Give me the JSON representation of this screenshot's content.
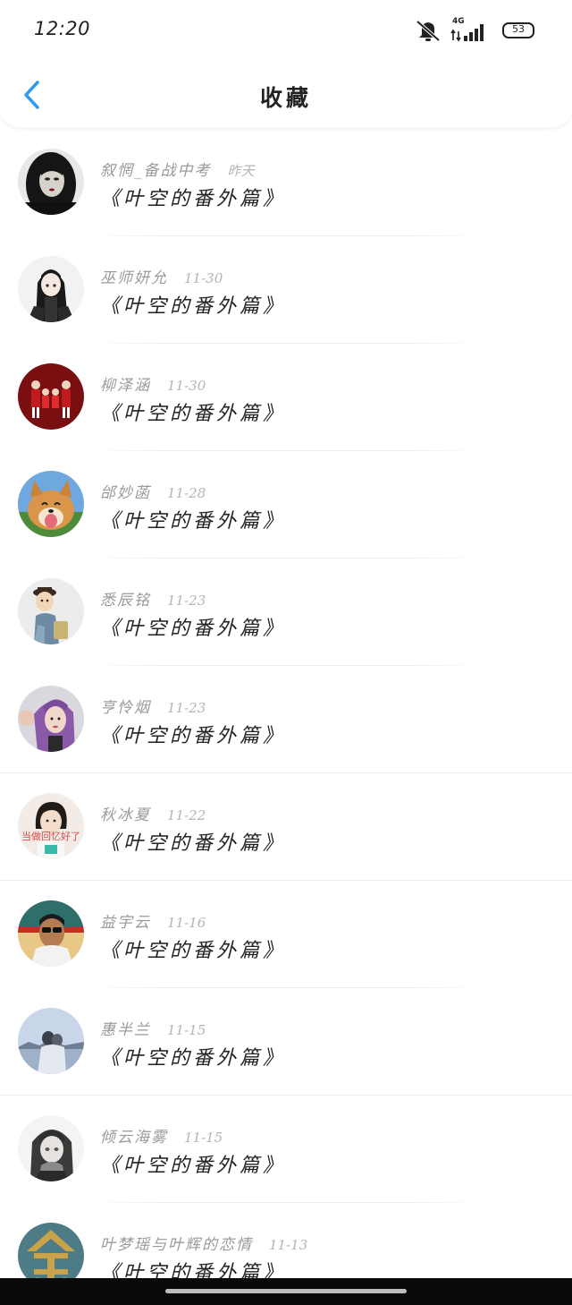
{
  "status_bar": {
    "time": "12:20",
    "network": "4G",
    "battery": "53"
  },
  "nav": {
    "title": "收藏"
  },
  "items": [
    {
      "author": "叙惘_备战中考",
      "date": "昨天",
      "title": "《叶空的番外篇》",
      "avatar": "dark-haired-girl-avatar"
    },
    {
      "author": "巫师妍允",
      "date": "11-30",
      "title": "《叶空的番外篇》",
      "avatar": "anime-girl-avatar"
    },
    {
      "author": "柳泽涵",
      "date": "11-30",
      "title": "《叶空的番外篇》",
      "avatar": "family-red-avatar"
    },
    {
      "author": "邰妙菡",
      "date": "11-28",
      "title": "《叶空的番外篇》",
      "avatar": "shiba-dog-avatar"
    },
    {
      "author": "悉辰铭",
      "date": "11-23",
      "title": "《叶空的番外篇》",
      "avatar": "cartoon-boy-avatar"
    },
    {
      "author": "亨怜烟",
      "date": "11-23",
      "title": "《叶空的番外篇》",
      "avatar": "purple-hair-girl-avatar"
    },
    {
      "author": "秋冰夏",
      "date": "11-22",
      "title": "《叶空的番外篇》",
      "avatar": "short-hair-girl-avatar",
      "avatar_text": "当做回忆好了"
    },
    {
      "author": "益宇云",
      "date": "11-16",
      "title": "《叶空的番外篇》",
      "avatar": "sunglasses-man-avatar"
    },
    {
      "author": "惠半兰",
      "date": "11-15",
      "title": "《叶空的番外篇》",
      "avatar": "couple-lake-avatar"
    },
    {
      "author": "倾云海雾",
      "date": "11-15",
      "title": "《叶空的番外篇》",
      "avatar": "gray-anime-girl-avatar"
    },
    {
      "author": "叶梦瑶与叶辉的恋情",
      "date": "11-13",
      "title": "《叶空的番外篇》",
      "avatar": "golden-character-avatar"
    }
  ],
  "colors": {
    "accent": "#2d9cf0",
    "title_text": "#222222",
    "meta_text": "#9a9a9a",
    "divider": "#ececec"
  }
}
